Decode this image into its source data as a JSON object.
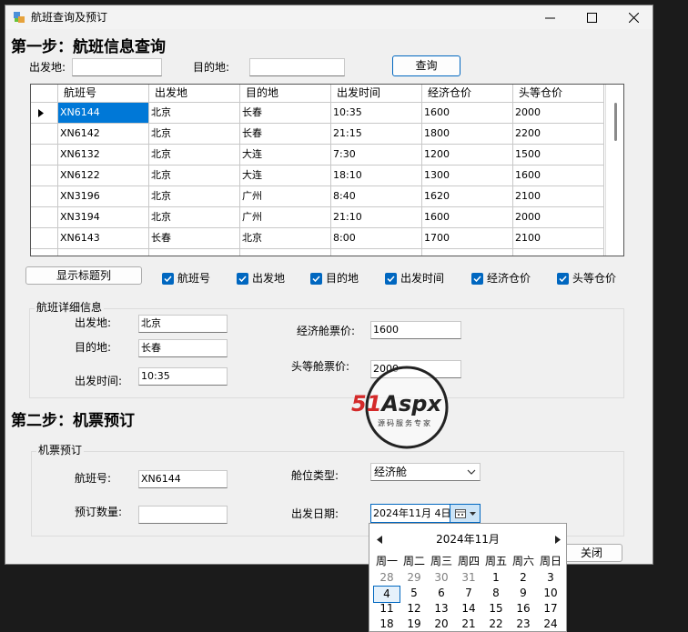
{
  "window": {
    "title": "航班查询及预订",
    "minimize_icon": "minimize-icon",
    "maximize_icon": "maximize-icon",
    "close_icon": "close-icon"
  },
  "step1": {
    "heading": "第一步：航班信息查询",
    "departure_label": "出发地:",
    "departure_value": "",
    "destination_label": "目的地:",
    "destination_value": "",
    "query_button": "查询"
  },
  "grid": {
    "columns": [
      "航班号",
      "出发地",
      "目的地",
      "出发时间",
      "经济仓价",
      "头等仓价"
    ],
    "rows": [
      [
        "XN6144",
        "北京",
        "长春",
        "10:35",
        "1600",
        "2000"
      ],
      [
        "XN6142",
        "北京",
        "长春",
        "21:15",
        "1800",
        "2200"
      ],
      [
        "XN6132",
        "北京",
        "大连",
        "7:30",
        "1200",
        "1500"
      ],
      [
        "XN6122",
        "北京",
        "大连",
        "18:10",
        "1300",
        "1600"
      ],
      [
        "XN3196",
        "北京",
        "广州",
        "8:40",
        "1620",
        "2100"
      ],
      [
        "XN3194",
        "北京",
        "广州",
        "21:10",
        "1600",
        "2000"
      ],
      [
        "XN6143",
        "长春",
        "北京",
        "8:00",
        "1700",
        "2100"
      ],
      [
        "",
        "",
        "",
        "",
        "",
        ""
      ]
    ],
    "selected_row": 0
  },
  "column_toggle": {
    "show_button": "显示标题列",
    "checkboxes": [
      {
        "label": "航班号",
        "checked": true
      },
      {
        "label": "出发地",
        "checked": true
      },
      {
        "label": "目的地",
        "checked": true
      },
      {
        "label": "出发时间",
        "checked": true
      },
      {
        "label": "经济仓价",
        "checked": true
      },
      {
        "label": "头等仓价",
        "checked": true
      }
    ]
  },
  "details": {
    "group_title": "航班详细信息",
    "departure_label": "出发地:",
    "departure_value": "北京",
    "destination_label": "目的地:",
    "destination_value": "长春",
    "time_label": "出发时间:",
    "time_value": "10:35",
    "economy_label": "经济舱票价:",
    "economy_value": "1600",
    "first_label": "头等舱票价:",
    "first_value": "2000"
  },
  "watermark": {
    "brand": "51Aspx",
    "tagline": "源码服务专家"
  },
  "step2": {
    "heading": "第二步：机票预订",
    "group_title": "机票预订",
    "flight_label": "航班号:",
    "flight_value": "XN6144",
    "quantity_label": "预订数量:",
    "quantity_value": "",
    "class_label": "舱位类型:",
    "class_value": "经济舱",
    "date_label": "出发日期:",
    "date_value": "2024年11月  4日",
    "close_button": "关闭"
  },
  "calendar": {
    "month_title": "2024年11月",
    "weekdays": [
      "周一",
      "周二",
      "周三",
      "周四",
      "周五",
      "周六",
      "周日"
    ],
    "weeks": [
      [
        "28",
        "29",
        "30",
        "31",
        "1",
        "2",
        "3"
      ],
      [
        "4",
        "5",
        "6",
        "7",
        "8",
        "9",
        "10"
      ],
      [
        "11",
        "12",
        "13",
        "14",
        "15",
        "16",
        "17"
      ],
      [
        "18",
        "19",
        "20",
        "21",
        "22",
        "23",
        "24"
      ]
    ],
    "selected_day": "4",
    "prev_icon": "chevron-left-icon",
    "next_icon": "chevron-right-icon"
  },
  "colors": {
    "accent": "#0067c0",
    "selection": "#0078d7",
    "window_bg": "#f0f0f0",
    "desktop": "#1b1b1b"
  }
}
